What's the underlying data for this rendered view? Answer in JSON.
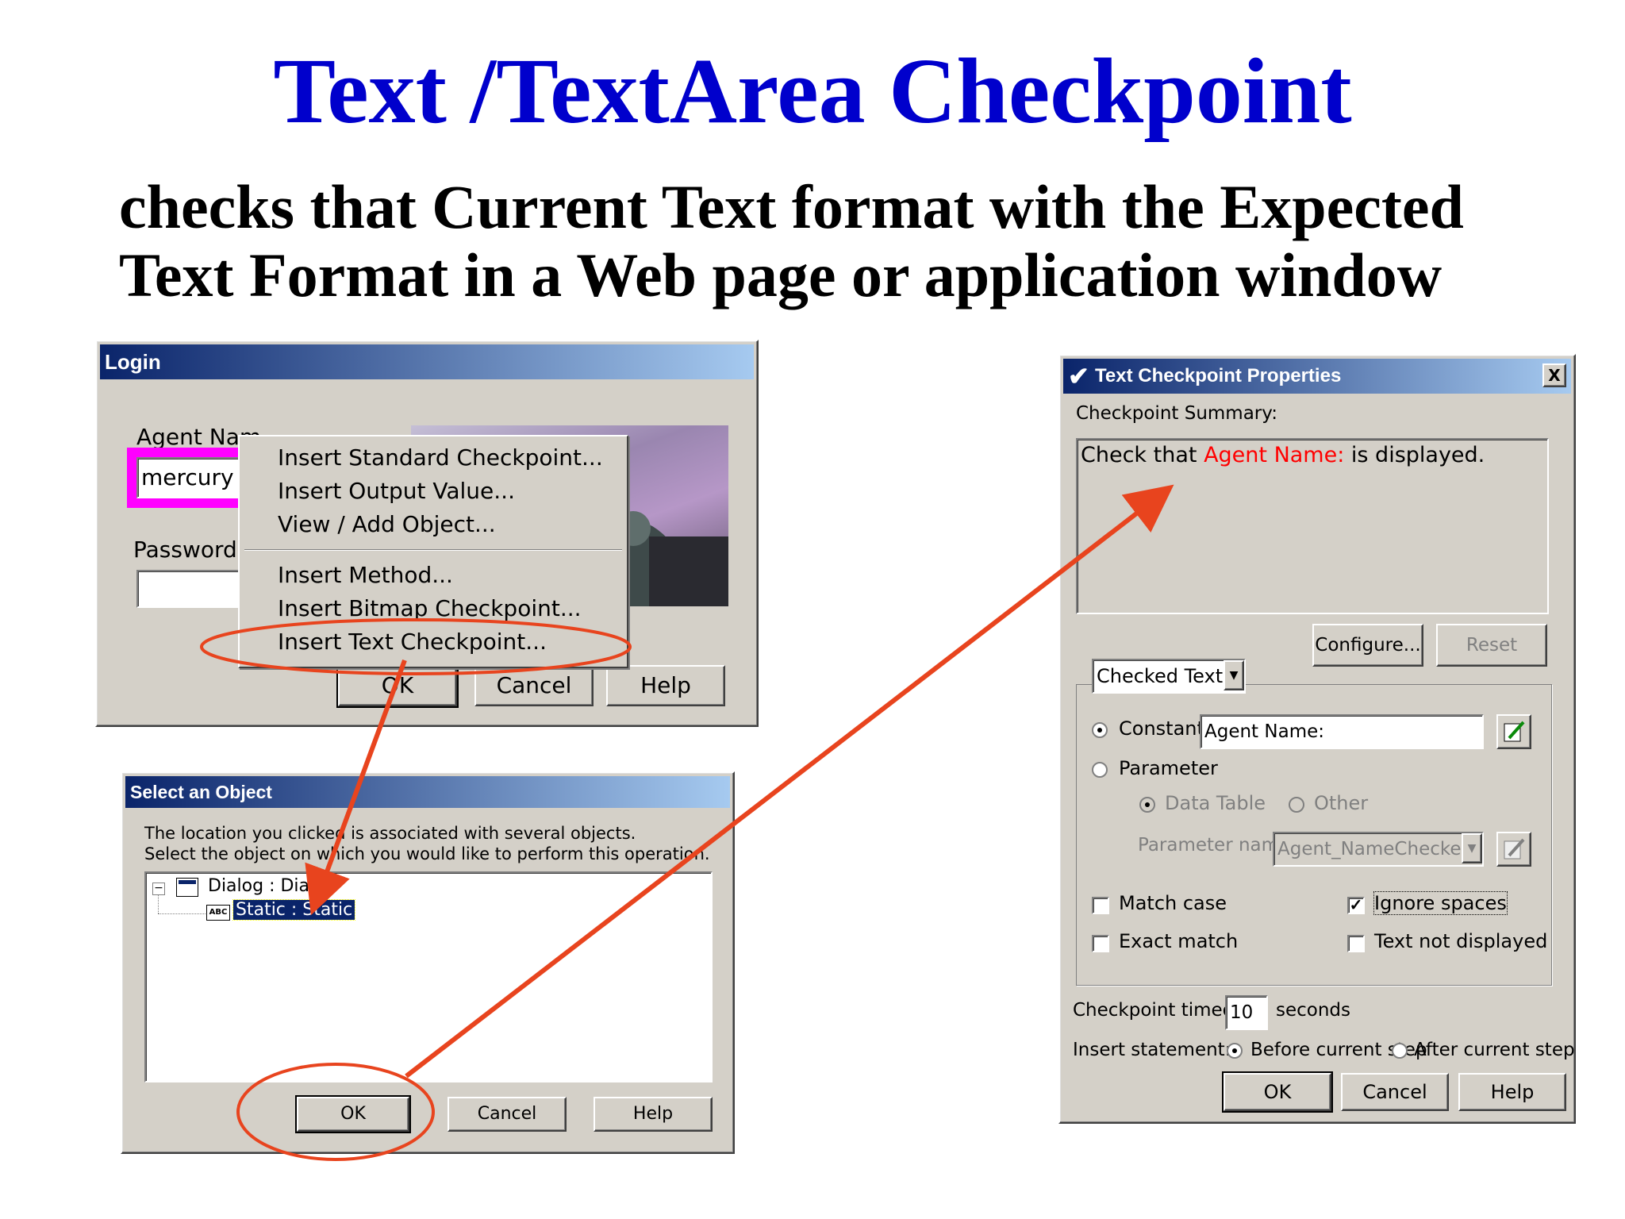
{
  "slide": {
    "title": "Text /TextArea Checkpoint",
    "subtitle_line1": "checks that Current Text format with the Expected",
    "subtitle_line2": "Text Format in a Web page or application window"
  },
  "login": {
    "title": "Login",
    "agent_label": "Agent Nam",
    "agent_value": "mercury",
    "password_label": "Password:",
    "ok": "OK",
    "cancel": "Cancel",
    "help": "Help"
  },
  "context_menu": {
    "items": [
      "Insert Standard Checkpoint...",
      "Insert Output Value...",
      "View / Add Object...",
      "Insert Method...",
      "Insert Bitmap Checkpoint...",
      "Insert Text Checkpoint..."
    ]
  },
  "select_object": {
    "title": "Select an Object",
    "line1": "The location you clicked is associated with several objects.",
    "line2": "Select the object on which you would like to perform this operation.",
    "tree_root": "Dialog : Dialog",
    "tree_child": "Static : Static",
    "ok": "OK",
    "cancel": "Cancel",
    "help": "Help"
  },
  "text_checkpoint": {
    "title": "Text Checkpoint Properties",
    "close": "X",
    "summary_label": "Checkpoint Summary:",
    "summary_prefix": "Check that ",
    "summary_highlight": "Agent Name:",
    "summary_suffix": " is  displayed.",
    "configure": "Configure...",
    "reset": "Reset",
    "dropdown_value": "Checked Text",
    "constant_label": "Constant",
    "constant_value": "Agent Name:",
    "parameter_label": "Parameter",
    "data_table_label": "Data Table",
    "other_label": "Other",
    "param_name_label": "Parameter name:",
    "param_name_value": "Agent_NameChecked_T",
    "match_case": "Match case",
    "ignore_spaces": "Ignore spaces",
    "exact_match": "Exact match",
    "text_not_displayed": "Text not displayed",
    "timeout_label": "Checkpoint timeout:",
    "timeout_value": "10",
    "seconds": "seconds",
    "insert_label": "Insert statement:",
    "before": "Before current step",
    "after": "After current step",
    "ok": "OK",
    "cancel": "Cancel",
    "help": "Help"
  },
  "colors": {
    "title_blue": "#0000cc",
    "annotation_red": "#e8441e",
    "highlight_magenta": "#ff00ff",
    "summary_red": "#ff0000"
  }
}
